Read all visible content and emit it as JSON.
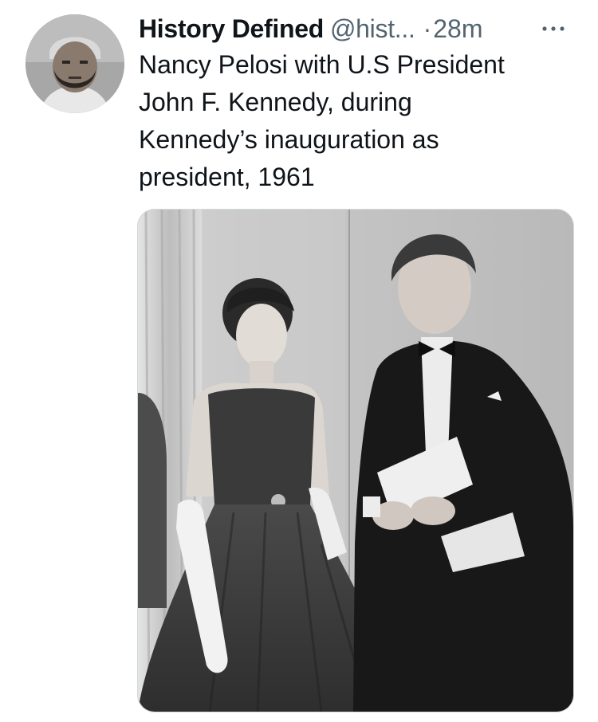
{
  "tweet": {
    "author": {
      "display_name": "History Defined",
      "handle": "@hist...",
      "avatar_icon": "profile-photo-icon"
    },
    "separator": "·",
    "timestamp": "28m",
    "more_icon": "ellipsis-icon",
    "text": "Nancy Pelosi with U.S President\nJohn F. Kennedy, during\nKennedy’s inauguration as\npresident, 1961",
    "media": {
      "type": "black-and-white-photo"
    }
  },
  "colors": {
    "primary_text": "#0f1419",
    "secondary_text": "#536471",
    "media_border": "#cfd9de"
  }
}
